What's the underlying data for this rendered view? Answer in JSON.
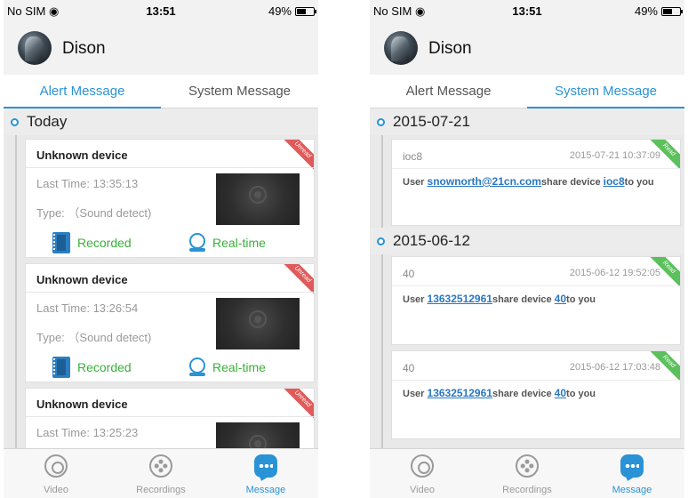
{
  "status_bar": {
    "carrier": "No SIM",
    "time": "13:51",
    "battery": "49%"
  },
  "user": {
    "name": "Dison"
  },
  "tabs": {
    "alert": "Alert Message",
    "system": "System Message"
  },
  "alert_view": {
    "day": "Today",
    "cards": [
      {
        "title": "Unknown device",
        "last_time": "Last Time: 13:35:13",
        "type": "Type: （Sound detect)",
        "badge": "Unread",
        "recorded": "Recorded",
        "realtime": "Real-time"
      },
      {
        "title": "Unknown device",
        "last_time": "Last Time: 13:26:54",
        "type": "Type: （Sound detect)",
        "badge": "Unread",
        "recorded": "Recorded",
        "realtime": "Real-time"
      },
      {
        "title": "Unknown device",
        "last_time": "Last Time: 13:25:23",
        "badge": "Unread"
      }
    ]
  },
  "system_view": {
    "days": [
      "2015-07-21",
      "2015-06-12"
    ],
    "messages": [
      {
        "device": "ioc8",
        "timestamp": "2015-07-21 10:37:09",
        "prefix": "User ",
        "user": "snownorth@21cn.com",
        "middle": "share device ",
        "device_link": "ioc8",
        "suffix": "to you",
        "badge": "Read"
      },
      {
        "device": "40",
        "timestamp": "2015-06-12 19:52:05",
        "prefix": "User ",
        "user": "13632512961",
        "middle": "share device ",
        "device_link": "40",
        "suffix": "to you",
        "badge": "Read"
      },
      {
        "device": "40",
        "timestamp": "2015-06-12 17:03:48",
        "prefix": "User ",
        "user": "13632512961",
        "middle": "share device ",
        "device_link": "40",
        "suffix": "to you",
        "badge": "Read"
      }
    ]
  },
  "tab_bar": {
    "video": "Video",
    "recordings": "Recordings",
    "message": "Message"
  },
  "colors": {
    "accent": "#2a93d5",
    "green_text": "#3ab03a",
    "unread_badge": "#e05a5a",
    "read_badge": "#5cc05c"
  },
  "icons": [
    "wifi-icon",
    "battery-icon",
    "avatar",
    "film-icon",
    "realtime-camera-icon",
    "video-icon",
    "recordings-icon",
    "message-icon"
  ]
}
